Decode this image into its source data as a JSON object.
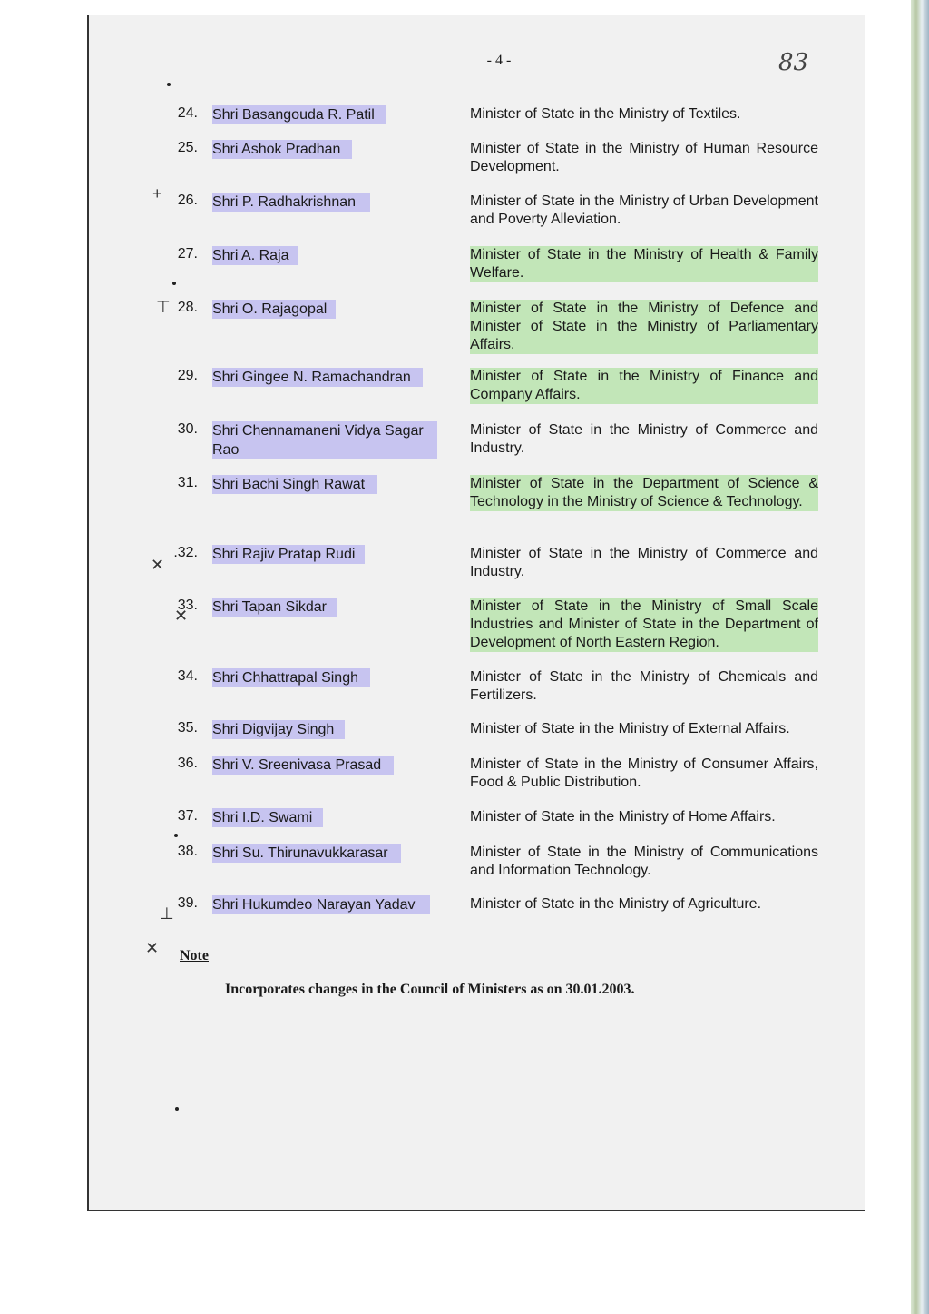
{
  "page_number": "- 4 -",
  "handwritten_folio": "83",
  "entries": [
    {
      "num": "24.",
      "name": "Shri Basangouda R. Patil",
      "desc": "Minister of State in the Ministry of Textiles."
    },
    {
      "num": "25.",
      "name": "Shri Ashok Pradhan",
      "desc": "Minister of State in the Ministry of Human Resource Development."
    },
    {
      "num": "26.",
      "name": "Shri P. Radhakrishnan",
      "desc": "Minister of State in the Ministry of Urban Development and Poverty Alleviation."
    },
    {
      "num": "27.",
      "name": "Shri A. Raja",
      "desc": "Minister of State in the Ministry of Health & Family Welfare."
    },
    {
      "num": "28.",
      "name": "Shri O. Rajagopal",
      "desc": "Minister of State in the Ministry of Defence and Minister of State in the Ministry of Parliamentary Affairs."
    },
    {
      "num": "29.",
      "name": "Shri Gingee N. Ramachandran",
      "desc": "Minister of State in the Ministry of Finance and Company Affairs."
    },
    {
      "num": "30.",
      "name": "Shri Chennamaneni Vidya Sagar Rao",
      "desc": "Minister of State in the Ministry of Commerce and Industry."
    },
    {
      "num": "31.",
      "name": "Shri Bachi Singh Rawat",
      "desc": "Minister of State in the Department of Science & Technology in the Ministry of Science & Technology."
    },
    {
      "num": ".32.",
      "name": "Shri Rajiv Pratap Rudi",
      "desc": "Minister of State in the Ministry of Commerce and Industry."
    },
    {
      "num": "33.",
      "name": "Shri Tapan Sikdar",
      "desc": "Minister of State in the Ministry of Small Scale Industries and Minister of State in the Department of Development of North Eastern Region."
    },
    {
      "num": "34.",
      "name": "Shri Chhattrapal Singh",
      "desc": "Minister of State in the Ministry of Chemicals and Fertilizers."
    },
    {
      "num": "35.",
      "name": "Shri Digvijay Singh",
      "desc": "Minister of State in the Ministry of External Affairs."
    },
    {
      "num": "36.",
      "name": "Shri V. Sreenivasa Prasad",
      "desc": "Minister of State in the Ministry of Consumer Affairs, Food & Public Distribution."
    },
    {
      "num": "37.",
      "name": "Shri I.D. Swami",
      "desc": "Minister of State in the Ministry of Home Affairs."
    },
    {
      "num": "38.",
      "name": "Shri Su. Thirunavukkarasar",
      "desc": "Minister of State in the Ministry of Communications and Information Technology."
    },
    {
      "num": "39.",
      "name": "Shri Hukumdeo Narayan Yadav",
      "desc": "Minister of State in the Ministry of Agriculture."
    }
  ],
  "note": {
    "label": "Note",
    "text": "Incorporates changes in the Council of Ministers as on  30.01.2003."
  }
}
